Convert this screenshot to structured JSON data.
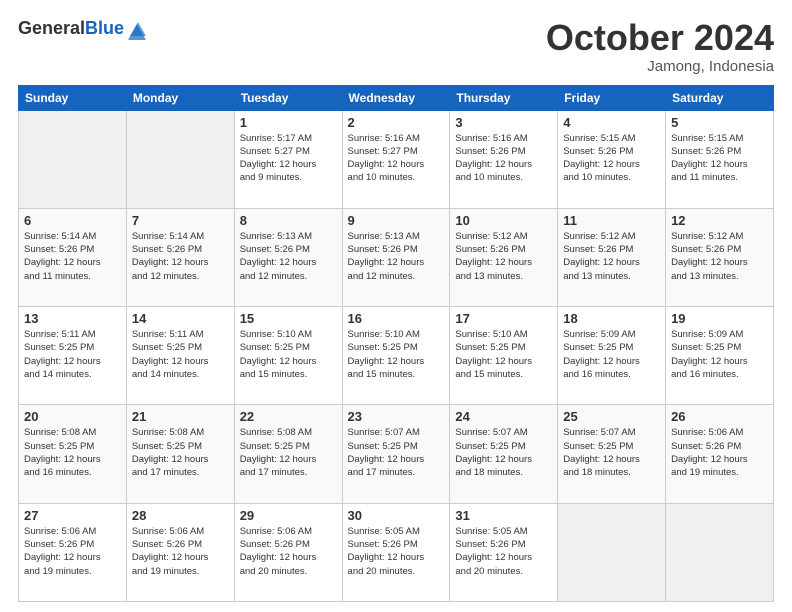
{
  "logo": {
    "general": "General",
    "blue": "Blue"
  },
  "header": {
    "month": "October 2024",
    "location": "Jamong, Indonesia"
  },
  "weekdays": [
    "Sunday",
    "Monday",
    "Tuesday",
    "Wednesday",
    "Thursday",
    "Friday",
    "Saturday"
  ],
  "weeks": [
    [
      {
        "day": "",
        "info": ""
      },
      {
        "day": "",
        "info": ""
      },
      {
        "day": "1",
        "info": "Sunrise: 5:17 AM\nSunset: 5:27 PM\nDaylight: 12 hours\nand 9 minutes."
      },
      {
        "day": "2",
        "info": "Sunrise: 5:16 AM\nSunset: 5:27 PM\nDaylight: 12 hours\nand 10 minutes."
      },
      {
        "day": "3",
        "info": "Sunrise: 5:16 AM\nSunset: 5:26 PM\nDaylight: 12 hours\nand 10 minutes."
      },
      {
        "day": "4",
        "info": "Sunrise: 5:15 AM\nSunset: 5:26 PM\nDaylight: 12 hours\nand 10 minutes."
      },
      {
        "day": "5",
        "info": "Sunrise: 5:15 AM\nSunset: 5:26 PM\nDaylight: 12 hours\nand 11 minutes."
      }
    ],
    [
      {
        "day": "6",
        "info": "Sunrise: 5:14 AM\nSunset: 5:26 PM\nDaylight: 12 hours\nand 11 minutes."
      },
      {
        "day": "7",
        "info": "Sunrise: 5:14 AM\nSunset: 5:26 PM\nDaylight: 12 hours\nand 12 minutes."
      },
      {
        "day": "8",
        "info": "Sunrise: 5:13 AM\nSunset: 5:26 PM\nDaylight: 12 hours\nand 12 minutes."
      },
      {
        "day": "9",
        "info": "Sunrise: 5:13 AM\nSunset: 5:26 PM\nDaylight: 12 hours\nand 12 minutes."
      },
      {
        "day": "10",
        "info": "Sunrise: 5:12 AM\nSunset: 5:26 PM\nDaylight: 12 hours\nand 13 minutes."
      },
      {
        "day": "11",
        "info": "Sunrise: 5:12 AM\nSunset: 5:26 PM\nDaylight: 12 hours\nand 13 minutes."
      },
      {
        "day": "12",
        "info": "Sunrise: 5:12 AM\nSunset: 5:26 PM\nDaylight: 12 hours\nand 13 minutes."
      }
    ],
    [
      {
        "day": "13",
        "info": "Sunrise: 5:11 AM\nSunset: 5:25 PM\nDaylight: 12 hours\nand 14 minutes."
      },
      {
        "day": "14",
        "info": "Sunrise: 5:11 AM\nSunset: 5:25 PM\nDaylight: 12 hours\nand 14 minutes."
      },
      {
        "day": "15",
        "info": "Sunrise: 5:10 AM\nSunset: 5:25 PM\nDaylight: 12 hours\nand 15 minutes."
      },
      {
        "day": "16",
        "info": "Sunrise: 5:10 AM\nSunset: 5:25 PM\nDaylight: 12 hours\nand 15 minutes."
      },
      {
        "day": "17",
        "info": "Sunrise: 5:10 AM\nSunset: 5:25 PM\nDaylight: 12 hours\nand 15 minutes."
      },
      {
        "day": "18",
        "info": "Sunrise: 5:09 AM\nSunset: 5:25 PM\nDaylight: 12 hours\nand 16 minutes."
      },
      {
        "day": "19",
        "info": "Sunrise: 5:09 AM\nSunset: 5:25 PM\nDaylight: 12 hours\nand 16 minutes."
      }
    ],
    [
      {
        "day": "20",
        "info": "Sunrise: 5:08 AM\nSunset: 5:25 PM\nDaylight: 12 hours\nand 16 minutes."
      },
      {
        "day": "21",
        "info": "Sunrise: 5:08 AM\nSunset: 5:25 PM\nDaylight: 12 hours\nand 17 minutes."
      },
      {
        "day": "22",
        "info": "Sunrise: 5:08 AM\nSunset: 5:25 PM\nDaylight: 12 hours\nand 17 minutes."
      },
      {
        "day": "23",
        "info": "Sunrise: 5:07 AM\nSunset: 5:25 PM\nDaylight: 12 hours\nand 17 minutes."
      },
      {
        "day": "24",
        "info": "Sunrise: 5:07 AM\nSunset: 5:25 PM\nDaylight: 12 hours\nand 18 minutes."
      },
      {
        "day": "25",
        "info": "Sunrise: 5:07 AM\nSunset: 5:25 PM\nDaylight: 12 hours\nand 18 minutes."
      },
      {
        "day": "26",
        "info": "Sunrise: 5:06 AM\nSunset: 5:26 PM\nDaylight: 12 hours\nand 19 minutes."
      }
    ],
    [
      {
        "day": "27",
        "info": "Sunrise: 5:06 AM\nSunset: 5:26 PM\nDaylight: 12 hours\nand 19 minutes."
      },
      {
        "day": "28",
        "info": "Sunrise: 5:06 AM\nSunset: 5:26 PM\nDaylight: 12 hours\nand 19 minutes."
      },
      {
        "day": "29",
        "info": "Sunrise: 5:06 AM\nSunset: 5:26 PM\nDaylight: 12 hours\nand 20 minutes."
      },
      {
        "day": "30",
        "info": "Sunrise: 5:05 AM\nSunset: 5:26 PM\nDaylight: 12 hours\nand 20 minutes."
      },
      {
        "day": "31",
        "info": "Sunrise: 5:05 AM\nSunset: 5:26 PM\nDaylight: 12 hours\nand 20 minutes."
      },
      {
        "day": "",
        "info": ""
      },
      {
        "day": "",
        "info": ""
      }
    ]
  ]
}
